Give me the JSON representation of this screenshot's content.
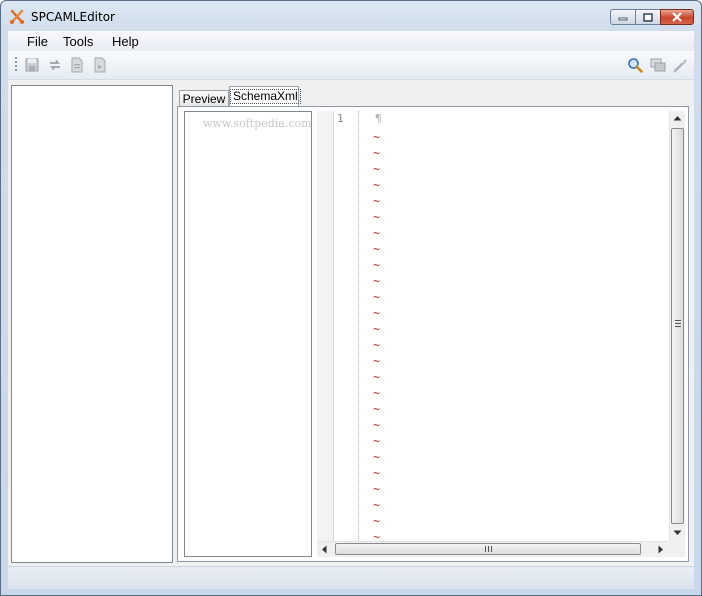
{
  "window": {
    "title": "SPCAMLEditor"
  },
  "menu": {
    "file": "File",
    "tools": "Tools",
    "help": "Help"
  },
  "toolbar": {
    "left_icons": [
      "save-icon",
      "refresh-icon",
      "document-icon",
      "document-export-icon"
    ],
    "right_icons": [
      "search-zoom-icon",
      "windows-icon",
      "wrench-icon"
    ]
  },
  "tabs": {
    "preview": "Preview",
    "schema": "SchemaXml"
  },
  "watermark": "www.softpedia.com",
  "editor": {
    "line_number": "1",
    "eol_marker": "¶",
    "empty_line_marker": "~"
  },
  "colors": {
    "accent_title": "#d9e4f1",
    "tilde": "#c0392b",
    "close_button": "#c9452b"
  }
}
